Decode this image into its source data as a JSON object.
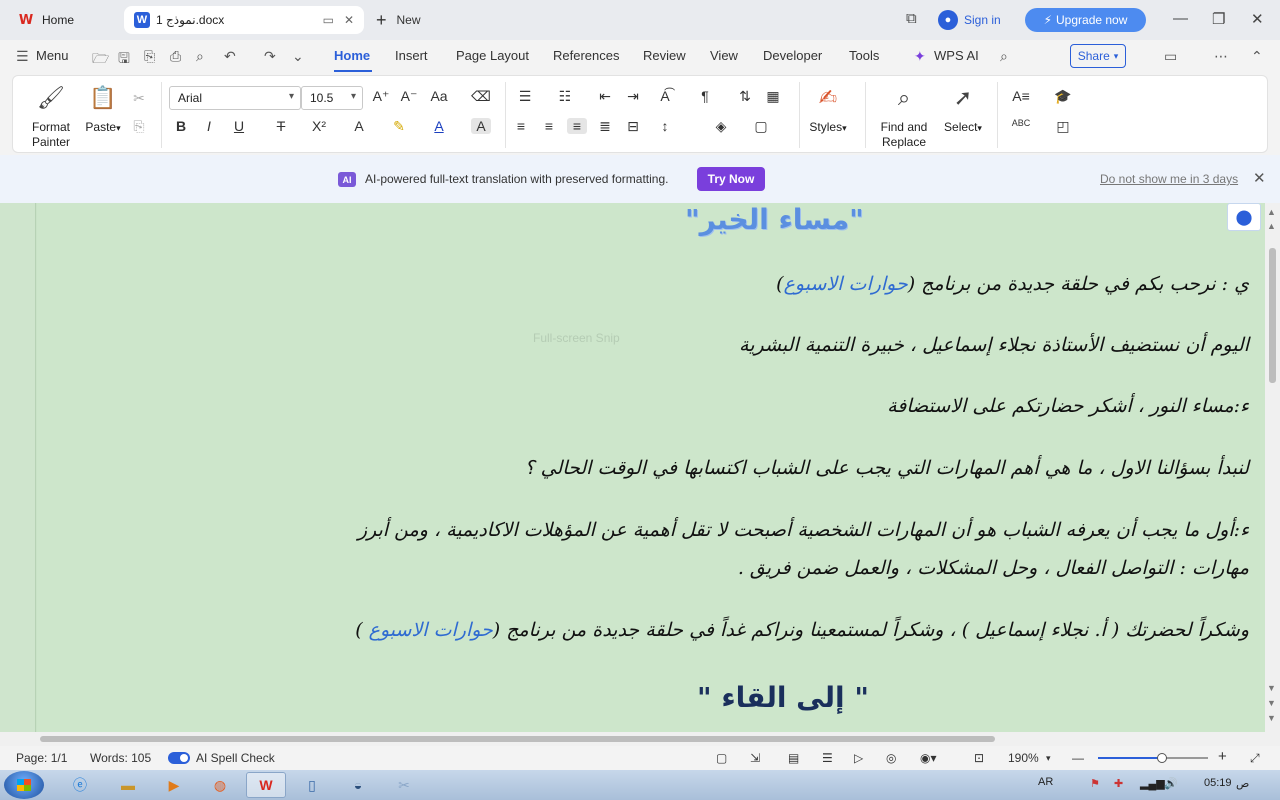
{
  "titlebar": {
    "home_tab": "Home",
    "doc_tab": "نموذج 1.docx",
    "new_tab": "New",
    "signin": "Sign in",
    "upgrade": "Upgrade now"
  },
  "menu": {
    "menu_label": "Menu",
    "tabs": [
      "Home",
      "Insert",
      "Page Layout",
      "References",
      "Review",
      "View",
      "Developer",
      "Tools"
    ],
    "wps_ai": "WPS AI",
    "share": "Share"
  },
  "ribbon": {
    "format_painter": "Format Painter",
    "paste": "Paste",
    "font_name": "Arial",
    "font_size": "10.5",
    "styles": "Styles",
    "find_replace": "Find and Replace",
    "select": "Select"
  },
  "notification": {
    "message": "AI-powered full-text translation with preserved formatting.",
    "try_now": "Try Now",
    "dismiss": "Do not show me in 3 days"
  },
  "document": {
    "title_top": "\"مساء الخير\"",
    "line1_prefix": "ي : نرحب بكم في حلقة جديدة من برنامج (",
    "line1_highlight": "حوارات الاسبوع",
    "line1_suffix": ")",
    "line2": "اليوم أن نستضيف الأستاذة نجلاء إسماعيل ، خبيرة التنمية البشرية",
    "line3": "ء:مساء النور ، أشكر حضارتكم على الاستضافة",
    "line4": "لنبدأ بسؤالنا الاول ، ما هي أهم المهارات التي يجب على الشباب اكتسابها في الوقت الحالي ؟",
    "line5": "ء:أول ما يجب أن يعرفه الشباب هو أن المهارات الشخصية أصبحت لا تقل أهمية عن المؤهلات الاكاديمية ، ومن أبرز",
    "line6": "مهارات : التواصل الفعال ، وحل المشكلات ، والعمل ضمن فريق .",
    "line7_prefix": "وشكراً لحضرتك ( أ. نجلاء إسماعيل ) ، وشكراً لمستمعينا ونراكم غداً في حلقة جديدة من برنامج (",
    "line7_highlight": "حوارات الاسبوع",
    "line7_suffix": " )",
    "title_bottom": "\" إلى القاء \"",
    "ghost_text": "Full-screen Snip"
  },
  "status": {
    "page": "Page: 1/1",
    "words": "Words: 105",
    "spell": "AI Spell Check",
    "zoom": "190%",
    "zoom_fraction": 0.58
  },
  "taskbar": {
    "lang": "AR",
    "time": "05:19",
    "ampm": "ص"
  }
}
